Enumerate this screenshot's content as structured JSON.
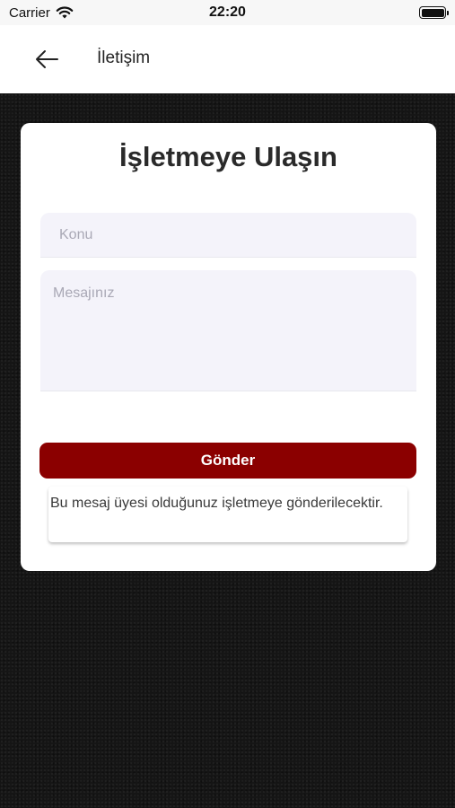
{
  "status_bar": {
    "carrier": "Carrier",
    "time": "22:20"
  },
  "nav": {
    "title": "İletişim"
  },
  "form": {
    "title": "İşletmeye Ulaşın",
    "subject_placeholder": "Konu",
    "message_placeholder": "Mesajınız",
    "send_label": "Gönder",
    "info_text": "Bu mesaj üyesi olduğunuz işletmeye gönderilecektir."
  },
  "colors": {
    "primary": "#8b0000",
    "field_bg": "#f4f3fa"
  }
}
